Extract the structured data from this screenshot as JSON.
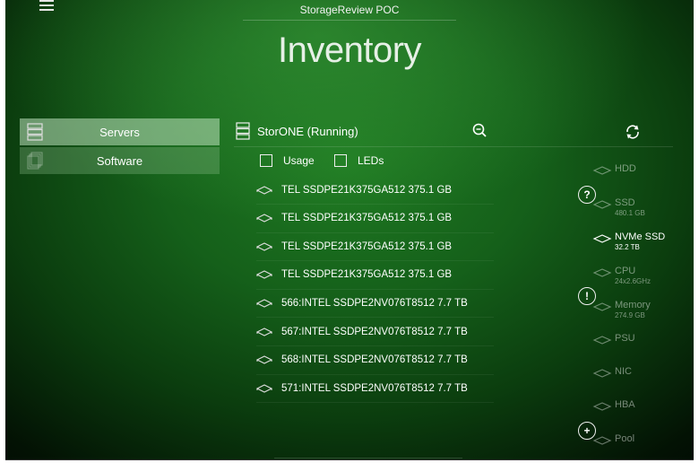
{
  "header": {
    "app_title": "StorageReview POC",
    "page_title": "Inventory",
    "menu_icon": "hamburger-menu-icon"
  },
  "sidebar": {
    "items": [
      {
        "label": "Servers",
        "icon": "server-rack-icon",
        "selected": true
      },
      {
        "label": "Software",
        "icon": "software-stack-icon",
        "selected": false
      }
    ]
  },
  "server": {
    "name": "StorONE (Running)",
    "icons": {
      "left": "server-icon",
      "search": "zoom-search-icon",
      "refresh": "refresh-icon"
    }
  },
  "filters": {
    "usage_label": "Usage",
    "leds_label": "LEDs"
  },
  "drives": [
    {
      "label": "TEL SSDPE21K375GA512 375.1 GB"
    },
    {
      "label": "TEL SSDPE21K375GA512 375.1 GB"
    },
    {
      "label": "TEL SSDPE21K375GA512 375.1 GB"
    },
    {
      "label": "TEL SSDPE21K375GA512 375.1 GB"
    },
    {
      "label": "566:INTEL SSDPE2NV076T8512 7.7 TB"
    },
    {
      "label": "567:INTEL SSDPE2NV076T8512 7.7 TB"
    },
    {
      "label": "568:INTEL SSDPE2NV076T8512 7.7 TB"
    },
    {
      "label": "571:INTEL SSDPE2NV076T8512 7.7 TB"
    }
  ],
  "categories": [
    {
      "name": "HDD",
      "sub": "",
      "active": false
    },
    {
      "name": "SSD",
      "sub": "480.1 GB",
      "active": false
    },
    {
      "name": "NVMe SSD",
      "sub": "32.2 TB",
      "active": true
    },
    {
      "name": "CPU",
      "sub": "24x2.6GHz",
      "active": false
    },
    {
      "name": "Memory",
      "sub": "274.9 GB",
      "active": false
    },
    {
      "name": "PSU",
      "sub": "",
      "active": false
    },
    {
      "name": "NIC",
      "sub": "",
      "active": false
    },
    {
      "name": "HBA",
      "sub": "",
      "active": false
    },
    {
      "name": "Pool",
      "sub": "",
      "active": false
    }
  ],
  "badges": {
    "help": "?",
    "alert": "!",
    "add": "+"
  },
  "colors": {
    "accent_green": "#1f7a22",
    "selected_bg": "#a8cfa8"
  }
}
